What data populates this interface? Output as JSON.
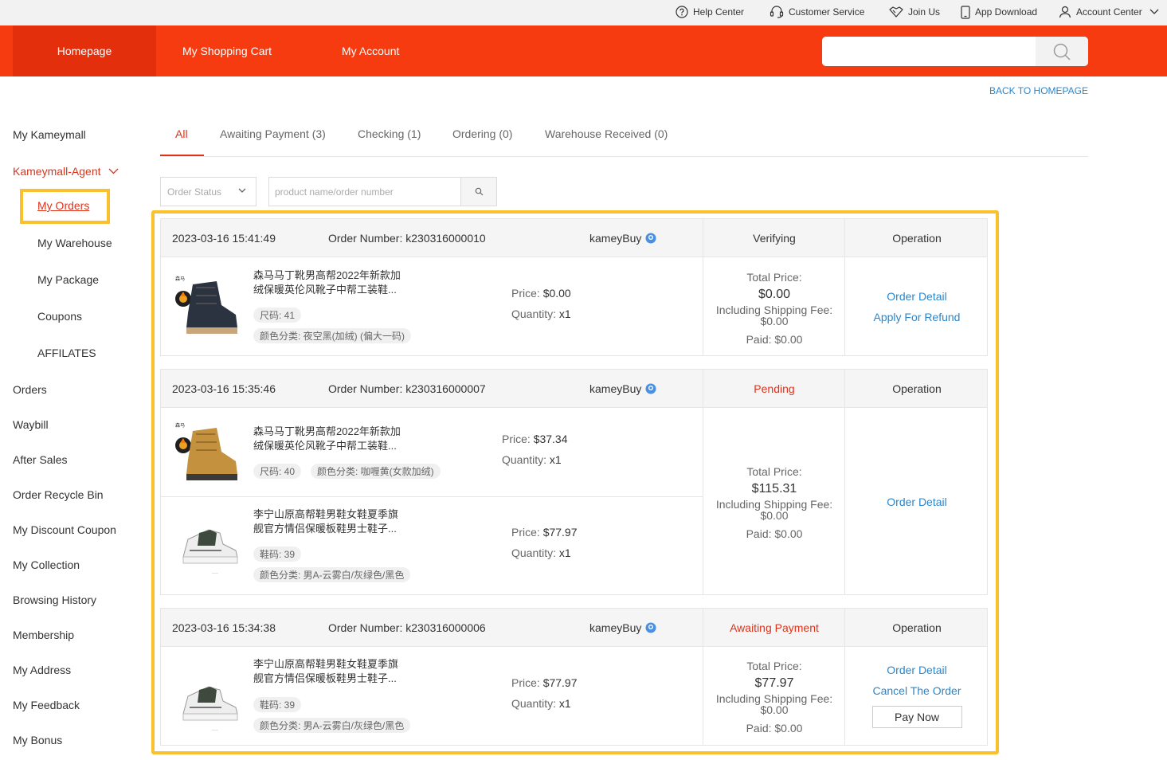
{
  "topbar": {
    "help_center": "Help Center",
    "customer_service": "Customer Service",
    "join_us": "Join Us",
    "app_download": "App Download",
    "account_center": "Account Center"
  },
  "nav": {
    "homepage": "Homepage",
    "cart": "My Shopping Cart",
    "account": "My Account",
    "search_value": ""
  },
  "back_link": "BACK TO HOMEPAGE",
  "sidebar": {
    "my_kameymall": "My Kameymall",
    "agent": "Kameymall-Agent",
    "my_orders": "My Orders",
    "my_warehouse": "My Warehouse",
    "my_package": "My Package",
    "coupons": "Coupons",
    "affiliates": "AFFILATES",
    "orders": "Orders",
    "waybill": "Waybill",
    "after_sales": "After Sales",
    "recycle_bin": "Order Recycle Bin",
    "discount_coupon": "My Discount Coupon",
    "collection": "My Collection",
    "history": "Browsing History",
    "membership": "Membership",
    "address": "My Address",
    "feedback": "My Feedback",
    "bonus": "My Bonus"
  },
  "tabs": {
    "all": "All",
    "awaiting": "Awaiting Payment (3)",
    "checking": "Checking (1)",
    "ordering": "Ordering (0)",
    "received": "Warehouse Received (0)"
  },
  "filters": {
    "status_placeholder": "Order Status",
    "search_placeholder": "product name/order number"
  },
  "labels": {
    "operation": "Operation",
    "total_price": "Total Price:",
    "shipping": "Including Shipping Fee:",
    "order_detail": "Order Detail",
    "refund": "Apply For Refund",
    "cancel": "Cancel The Order",
    "pay_now": "Pay Now"
  },
  "colors": {
    "brand": "#f53b0f",
    "link": "#2d86c9",
    "status_red": "#e0321a",
    "highlight": "#fbc02d"
  },
  "orders": [
    {
      "date": "2023-03-16 15:41:49",
      "number": "Order Number: k230316000010",
      "shop": "kameyBuy",
      "status": "Verifying",
      "total": "$0.00",
      "shipping": "$0.00",
      "paid": "Paid: $0.00",
      "items": [
        {
          "name1": "森马马丁靴男高帮2022年新款加",
          "name2": "绒保暖英伦风靴子中帮工装鞋...",
          "size": "尺码: 41",
          "color": "颜色分类: 夜空黑(加绒) (偏大一码)",
          "price_label": "Price: ",
          "price": "$0.00",
          "qty_label": "Quantity: ",
          "qty": "x1"
        }
      ]
    },
    {
      "date": "2023-03-16 15:35:46",
      "number": "Order Number: k230316000007",
      "shop": "kameyBuy",
      "status": "Pending",
      "total": "$115.31",
      "shipping": "$0.00",
      "paid": "Paid: $0.00",
      "items": [
        {
          "name1": "森马马丁靴男高帮2022年新款加",
          "name2": "绒保暖英伦风靴子中帮工装鞋...",
          "size": "尺码: 40",
          "color": "颜色分类: 咖喱黄(女款加绒)",
          "price_label": "Price: ",
          "price": "$37.34",
          "qty_label": "Quantity: ",
          "qty": "x1"
        },
        {
          "name1": "李宁山原高帮鞋男鞋女鞋夏季旗",
          "name2": "舰官方情侣保暖板鞋男士鞋子...",
          "size": "鞋码: 39",
          "color": "颜色分类: 男A-云雾白/灰绿色/黑色",
          "price_label": "Price: ",
          "price": "$77.97",
          "qty_label": "Quantity: ",
          "qty": "x1"
        }
      ]
    },
    {
      "date": "2023-03-16 15:34:38",
      "number": "Order Number: k230316000006",
      "shop": "kameyBuy",
      "status": "Awaiting Payment",
      "total": "$77.97",
      "shipping": "$0.00",
      "paid": "Paid: $0.00",
      "items": [
        {
          "name1": "李宁山原高帮鞋男鞋女鞋夏季旗",
          "name2": "舰官方情侣保暖板鞋男士鞋子...",
          "size": "鞋码: 39",
          "color": "颜色分类: 男A-云雾白/灰绿色/黑色",
          "price_label": "Price: ",
          "price": "$77.97",
          "qty_label": "Quantity: ",
          "qty": "x1"
        }
      ]
    }
  ]
}
